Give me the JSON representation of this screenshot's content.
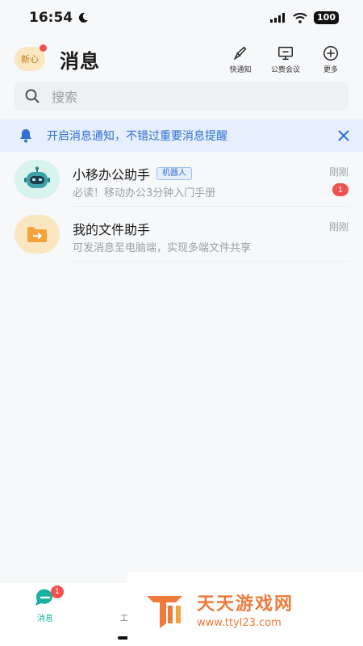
{
  "status_bar": {
    "time": "16:54",
    "battery": "100"
  },
  "header": {
    "avatar_text": "新心",
    "title": "消息",
    "actions": [
      {
        "label": "快通知",
        "icon": "rocket-icon"
      },
      {
        "label": "公费会议",
        "icon": "meeting-screen-icon"
      },
      {
        "label": "更多",
        "icon": "plus-circle-icon"
      }
    ]
  },
  "search": {
    "placeholder": "搜索"
  },
  "notice": {
    "text": "开启消息通知，不错过重要消息提醒"
  },
  "chats": [
    {
      "name": "小移办公助手",
      "tag": "机器人",
      "preview": "必读！移动办公3分钟入门手册",
      "time": "刚刚",
      "badge": "1"
    },
    {
      "name": "我的文件助手",
      "tag": "",
      "preview": "可发消息至电脑端，实现多端文件共享",
      "time": "刚刚",
      "badge": ""
    }
  ],
  "tabbar": {
    "tabs": [
      {
        "label": "消息",
        "badge": "1"
      },
      {
        "label": "工"
      }
    ]
  },
  "watermark": {
    "title": "天天游戏网",
    "url": "www.ttyl23.com"
  },
  "colors": {
    "accent": "#17b0a2",
    "link_blue": "#2f6fd6",
    "badge_red": "#f2524f"
  }
}
